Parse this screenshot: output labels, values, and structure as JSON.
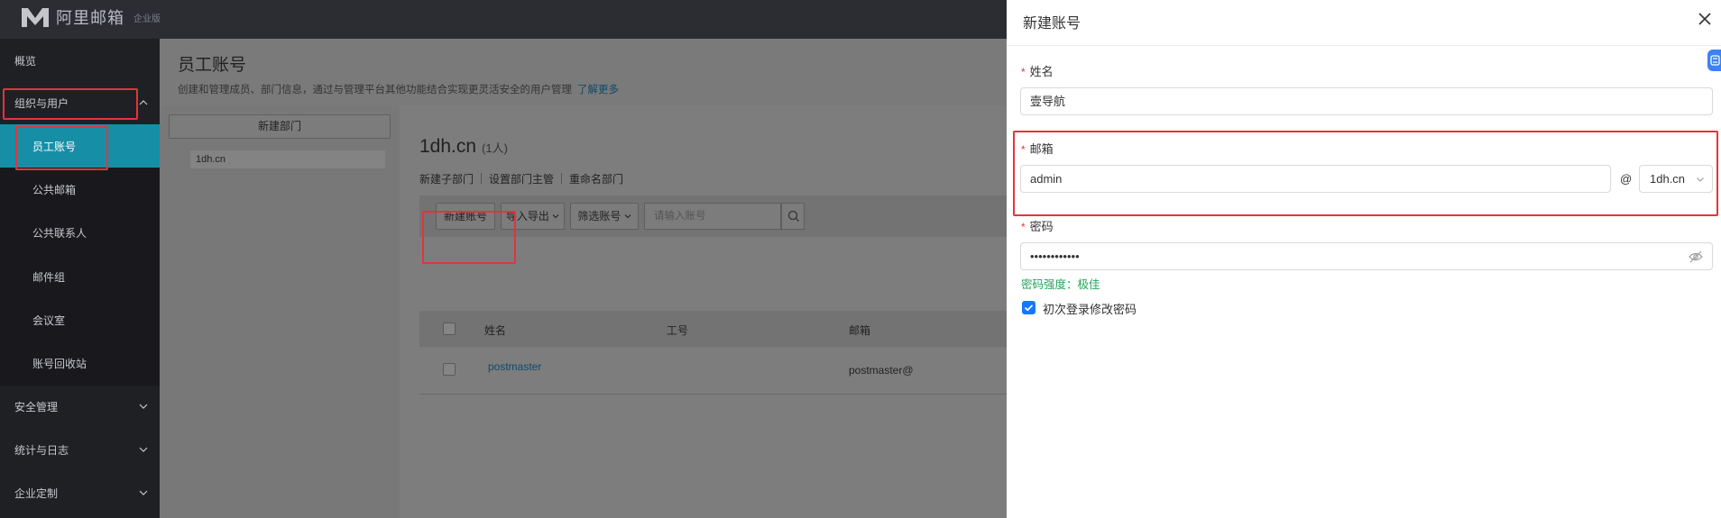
{
  "app": {
    "logo_text": "阿里邮箱",
    "logo_sub": "企业版"
  },
  "sidebar": {
    "items": [
      {
        "label": "概览"
      },
      {
        "label": "组织与用户"
      },
      {
        "label": "员工账号"
      },
      {
        "label": "公共邮箱"
      },
      {
        "label": "公共联系人"
      },
      {
        "label": "邮件组"
      },
      {
        "label": "会议室"
      },
      {
        "label": "账号回收站"
      },
      {
        "label": "安全管理"
      },
      {
        "label": "统计与日志"
      },
      {
        "label": "企业定制"
      }
    ]
  },
  "page": {
    "title": "员工账号",
    "description": "创建和管理成员、部门信息，通过与管理平台其他功能结合实现更灵活安全的用户管理",
    "learn_more": "了解更多"
  },
  "departments": {
    "new_button": "新建部门",
    "items": [
      "1dh.cn"
    ]
  },
  "dept_detail": {
    "name": "1dh.cn",
    "count": "(1人)",
    "links": [
      "新建子部门",
      "设置部门主管",
      "重命名部门"
    ]
  },
  "toolbar": {
    "new_account": "新建账号",
    "import_export": "导入导出",
    "filter": "筛选账号",
    "search_placeholder": "请输入账号"
  },
  "table": {
    "headers": [
      "姓名",
      "工号",
      "邮箱"
    ],
    "rows": [
      {
        "name": "postmaster",
        "email": "postmaster@"
      }
    ]
  },
  "drawer": {
    "title": "新建账号",
    "name_label": "姓名",
    "name_value": "壹导航",
    "email_label": "邮箱",
    "email_value": "admin",
    "at_sign": "@",
    "domain_value": "1dh.cn",
    "password_label": "密码",
    "password_value": "••••••••••••",
    "strength_text": "密码强度：极佳",
    "checkbox_label": "初次登录修改密码",
    "required_mark": "*"
  }
}
